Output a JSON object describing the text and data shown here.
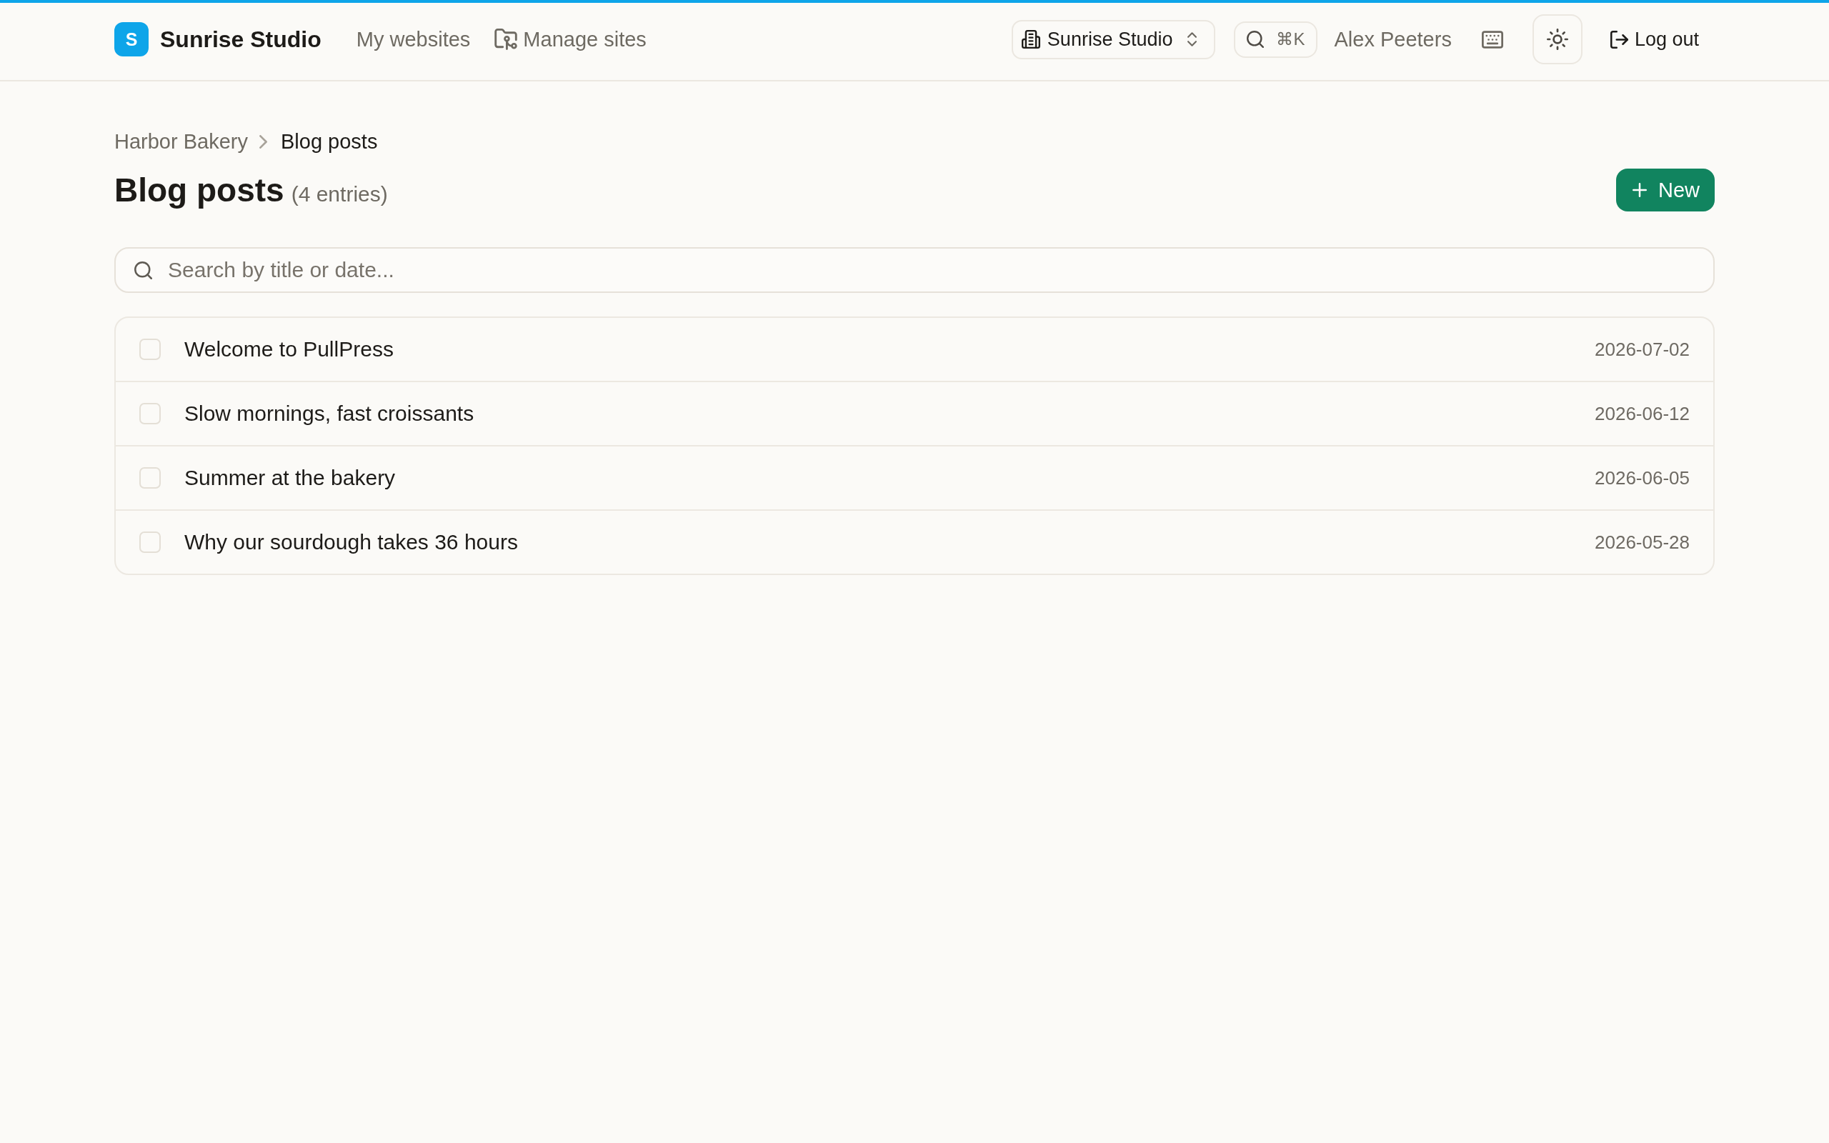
{
  "top_nav": {
    "brand": {
      "logo_letter": "S",
      "name": "Sunrise Studio"
    },
    "links": [
      {
        "label": "My websites",
        "kind": "plain"
      },
      {
        "label": "Manage sites",
        "kind": "folder"
      }
    ],
    "workspace_switcher": {
      "label": "Sunrise Studio"
    },
    "search_shortcut": "⌘K",
    "user_name": "Alex Peeters",
    "logout": "Log out"
  },
  "breadcrumb": [
    {
      "label": "Harbor Bakery",
      "current": false
    },
    {
      "label": "Blog posts",
      "current": true
    }
  ],
  "page": {
    "title": "Blog posts",
    "count": "(4 entries)",
    "new_button": "New"
  },
  "search": {
    "placeholder": "Search by title or date..."
  },
  "posts": [
    {
      "title": "Welcome to PullPress",
      "date": "2026-07-02",
      "checked": false
    },
    {
      "title": "Slow mornings, fast croissants",
      "date": "2026-06-12",
      "checked": false
    },
    {
      "title": "Summer at the bakery",
      "date": "2026-06-05",
      "checked": false
    },
    {
      "title": "Why our sourdough takes 36 hours",
      "date": "2026-05-28",
      "checked": false
    }
  ]
}
